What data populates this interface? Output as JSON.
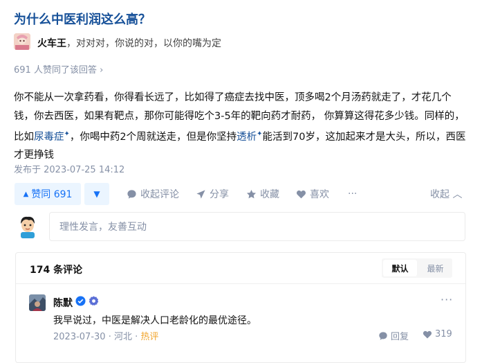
{
  "question": {
    "title": "为什么中医利润这么高？"
  },
  "author": {
    "name": "火车王",
    "bio": "，对对对，你说的对，以你的嘴为定"
  },
  "answer": {
    "upvote_info": "691 人赞同了该回答 ›",
    "part1": "你不能从一次拿药看，你得看长远了，比如得了癌症去找中医，顶多喝2个月汤药就走了，才花几个钱，你去西医，如果有靶点，那你可能得吃个3-5年的靶向药才耐药， 你算算这得花多少钱。同样的，比如",
    "link1": "尿毒症",
    "part2": "，你喝中药2个周就送走，但是你坚持",
    "link2": "透析",
    "part3": "能活到70岁，这加起来才是大头，所以，西医才更挣钱",
    "spark": "✦",
    "published": "发布于 2023-07-25 14:12"
  },
  "actions": {
    "upvote_label": "赞同 691",
    "upvote_icon": "▲",
    "downvote_icon": "▼",
    "comment": "收起评论",
    "share": "分享",
    "favorite": "收藏",
    "like": "喜欢",
    "more": "···",
    "collapse": "收起 ︿"
  },
  "comment_input": {
    "placeholder": "理性发言，友善互动"
  },
  "comments": {
    "count": "174 条评论",
    "sort_default": "默认",
    "sort_latest": "最新",
    "items": [
      {
        "author": "陈默",
        "text": "我早说过，中医是解决人口老龄化的最优途径。",
        "date": "2023-07-30",
        "sep": "·",
        "location": "河北",
        "tag": "热评",
        "reply": "回复",
        "likes": "319",
        "more": "···"
      }
    ]
  },
  "colors": {
    "accent": "#1772f6",
    "link": "#175199",
    "muted": "#8590a6",
    "hot": "#f1a52d"
  }
}
